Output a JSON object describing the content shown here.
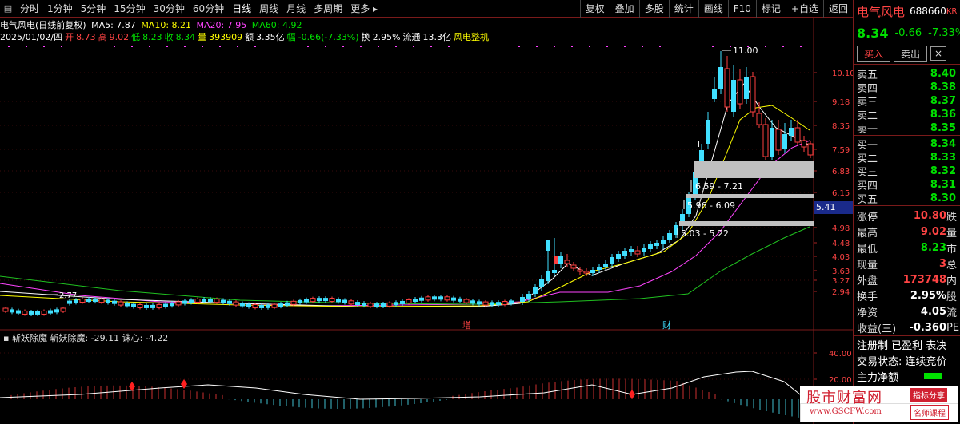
{
  "toolbar": {
    "timeframes": [
      "分时",
      "1分钟",
      "5分钟",
      "15分钟",
      "30分钟",
      "60分钟",
      "日线",
      "周线",
      "月线",
      "多周期",
      "更多"
    ],
    "active_timeframe": "日线",
    "right_buttons": [
      "复权",
      "叠加",
      "多股",
      "统计",
      "画线",
      "F10",
      "标记",
      "+自选",
      "返回"
    ]
  },
  "info": {
    "line1": "电气风电(日线前复权)",
    "ma5": "MA5: 7.87",
    "ma10": "MA10: 8.21",
    "ma20": "MA20: 7.95",
    "ma60": "MA60: 4.92",
    "date": "2025/01/02/四",
    "open_label": "开",
    "open": "8.73",
    "high_label": "高",
    "high": "9.02",
    "low_label": "低",
    "low": "8.23",
    "close_label": "收",
    "close": "8.34",
    "vol_label": "量",
    "vol": "393909",
    "amt_label": "额",
    "amt": "3.35亿",
    "chg_label": "幅",
    "chg": "-0.66(-7.33%)",
    "turn_label": "换",
    "turn": "2.95%",
    "float_label": "流通",
    "float": "13.3亿",
    "concept": "风电整机"
  },
  "chart": {
    "price_ticks": [
      "10.10",
      "9.18",
      "8.35",
      "7.59",
      "6.83",
      "6.15",
      "5.41",
      "4.98",
      "4.48",
      "4.03",
      "3.63",
      "3.27",
      "2.94"
    ],
    "peak_label": "11.00",
    "low_label": "2.77",
    "zone1": "6.59 - 7.21",
    "zone2": "5.96 - 6.09",
    "zone3": "5.03 - 5.22",
    "t_mark": "T",
    "mark_zeng": "增",
    "mark_cai": "财",
    "current_price_tag": "5.41"
  },
  "indicator": {
    "name": "斩妖除魔",
    "val1": "斩妖除魔: -29.11",
    "val2": "诛心: -4.22",
    "ticks": [
      "40.00",
      "20.00"
    ]
  },
  "stock": {
    "name": "电气风电",
    "code": "688660",
    "kr": "KR",
    "price": "8.34",
    "change": "-0.66",
    "pct": "-7.33%",
    "buy_btn": "买入",
    "sell_btn": "卖出",
    "x_btn": "×"
  },
  "orderbook": {
    "asks": [
      {
        "label": "卖五",
        "price": "8.40"
      },
      {
        "label": "卖四",
        "price": "8.38"
      },
      {
        "label": "卖三",
        "price": "8.37"
      },
      {
        "label": "卖二",
        "price": "8.36"
      },
      {
        "label": "卖一",
        "price": "8.35"
      }
    ],
    "bids": [
      {
        "label": "买一",
        "price": "8.34"
      },
      {
        "label": "买二",
        "price": "8.33"
      },
      {
        "label": "买三",
        "price": "8.32"
      },
      {
        "label": "买四",
        "price": "8.31"
      },
      {
        "label": "买五",
        "price": "8.30"
      }
    ]
  },
  "stats": [
    {
      "label": "涨停",
      "value": "10.80",
      "tail": "跌",
      "color": "red"
    },
    {
      "label": "最高",
      "value": "9.02",
      "tail": "量",
      "color": "red"
    },
    {
      "label": "最低",
      "value": "8.23",
      "tail": "市",
      "color": "green"
    },
    {
      "label": "现量",
      "value": "3",
      "tail": "总",
      "color": "red"
    },
    {
      "label": "外盘",
      "value": "173748",
      "tail": "内",
      "color": "red"
    },
    {
      "label": "换手",
      "value": "2.95%",
      "tail": "股",
      "color": "white"
    },
    {
      "label": "净资",
      "value": "4.05",
      "tail": "流",
      "color": "white"
    },
    {
      "label": "收益(三)",
      "value": "-0.360",
      "tail": "PE",
      "color": "white"
    }
  ],
  "footer": {
    "reg": "注册制 已盈利 表决",
    "status": "交易状态: 连续竞价",
    "netflow": "主力净额"
  },
  "watermark": {
    "main": "股市财富网",
    "url": "www.GSCFW.com",
    "tag1": "指标分享",
    "tag2": "名师课程"
  }
}
